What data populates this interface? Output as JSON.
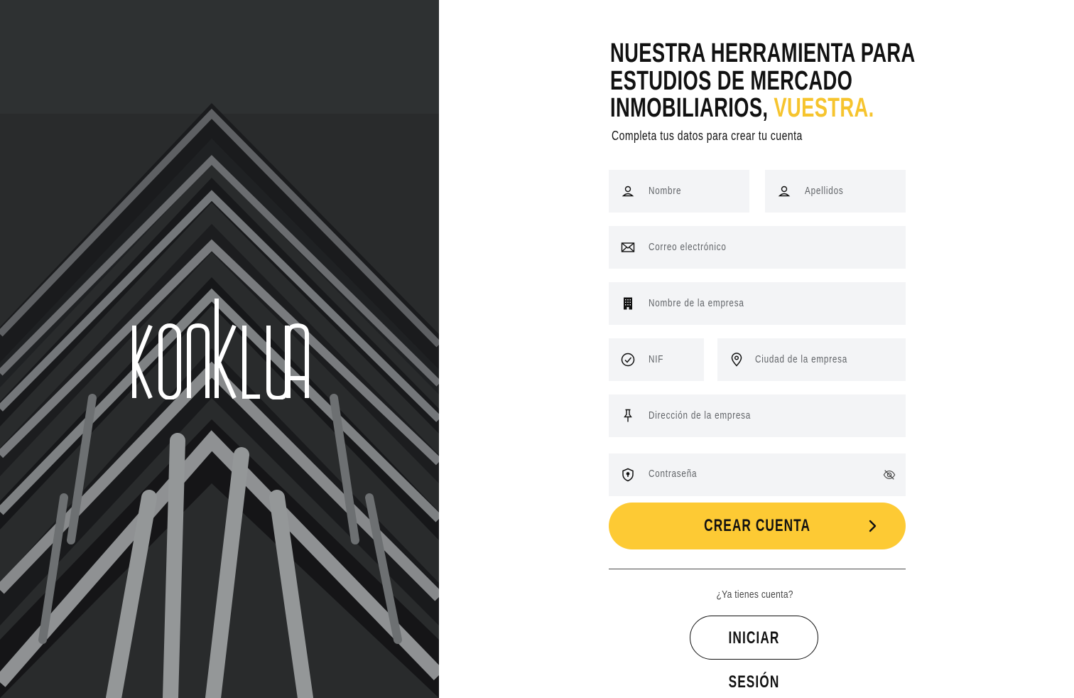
{
  "brand": {
    "logo_text": "KONKLUA"
  },
  "headline": {
    "line1": "NUESTRA HERRAMIENTA PARA",
    "line2": "ESTUDIOS DE MERCADO",
    "line3_prefix": "INMOBILIARIOS,",
    "line3_accent": "VUESTRA."
  },
  "subtitle": "Completa tus datos para crear tu cuenta",
  "form": {
    "nombre": {
      "placeholder": "Nombre",
      "icon": "user-icon"
    },
    "apellidos": {
      "placeholder": "Apellidos",
      "icon": "user-icon"
    },
    "email": {
      "placeholder": "Correo electrónico",
      "icon": "envelope-icon"
    },
    "empresa": {
      "placeholder": "Nombre de la empresa",
      "icon": "building-icon"
    },
    "nif": {
      "placeholder": "NIF",
      "icon": "check-circle-icon"
    },
    "ciudad": {
      "placeholder": "Ciudad de la empresa",
      "icon": "map-pin-icon"
    },
    "direccion": {
      "placeholder": "Dirección de la empresa",
      "icon": "pushpin-icon"
    },
    "password": {
      "placeholder": "Contraseña",
      "icon": "shield-lock-icon",
      "toggle_icon": "eye-off-icon"
    }
  },
  "actions": {
    "create_label": "CREAR CUENTA",
    "have_account": "¿Ya tienes cuenta?",
    "login_label": "INICIAR SESIÓN"
  },
  "colors": {
    "accent": "#fdca34",
    "field_bg": "#f3f4f6",
    "hero_bg": "#2b2d2e"
  }
}
